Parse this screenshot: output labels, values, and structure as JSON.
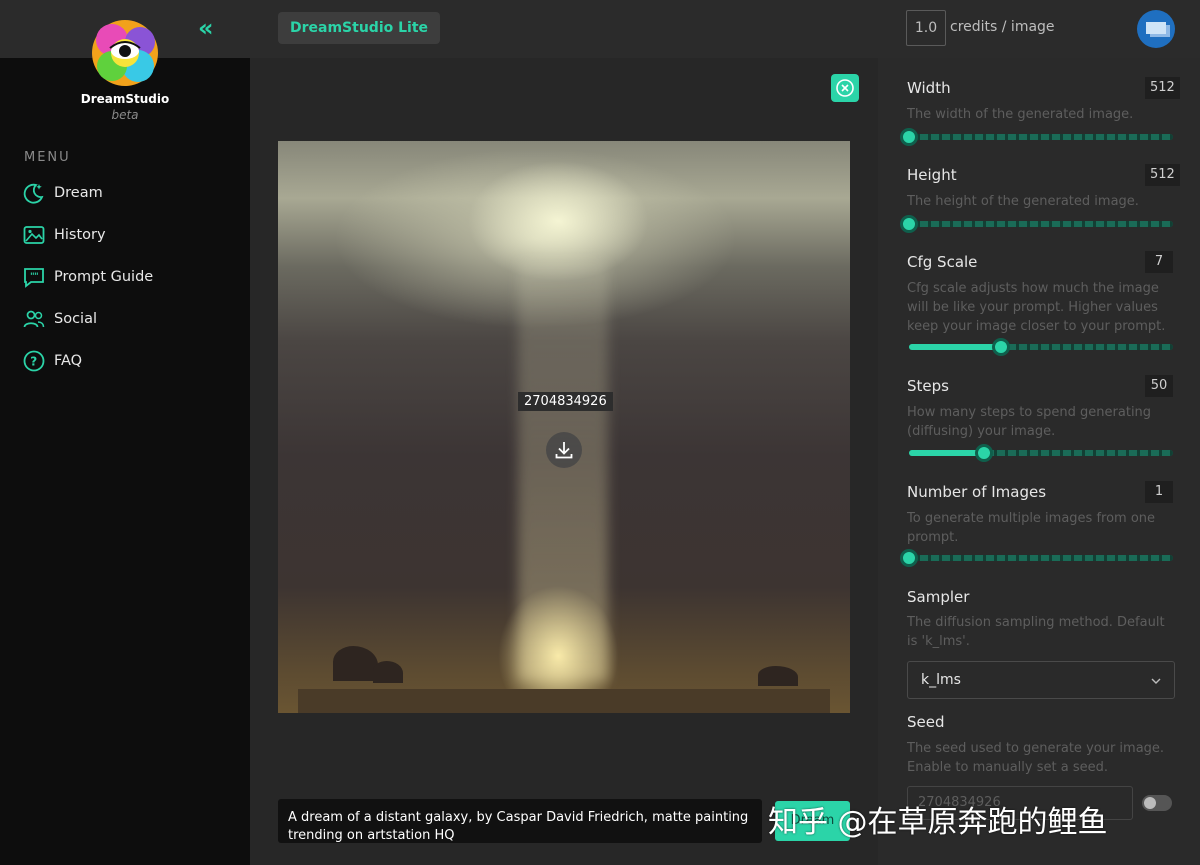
{
  "header": {
    "collapse_glyph": "«",
    "brand_pill": "DreamStudio Lite",
    "credits_value": "1.0",
    "credits_label": "credits / image"
  },
  "sidebar": {
    "logo_title": "DreamStudio",
    "logo_subtitle": "beta",
    "menu_heading": "MENU",
    "items": [
      {
        "label": "Dream",
        "icon": "moon-stars-icon"
      },
      {
        "label": "History",
        "icon": "image-icon"
      },
      {
        "label": "Prompt Guide",
        "icon": "quote-bubble-icon"
      },
      {
        "label": "Social",
        "icon": "users-icon"
      },
      {
        "label": "FAQ",
        "icon": "question-circle-icon"
      }
    ]
  },
  "main": {
    "seed_tag": "2704834926",
    "prompt": "A dream of a distant galaxy, by Caspar David Friedrich, matte painting trending on artstation HQ",
    "dream_button": "Dream"
  },
  "settings": {
    "width": {
      "title": "Width",
      "value": "512",
      "desc": "The width of the generated image.",
      "fraction": 0.0
    },
    "height": {
      "title": "Height",
      "value": "512",
      "desc": "The height of the generated image.",
      "fraction": 0.0
    },
    "cfg": {
      "title": "Cfg Scale",
      "value": "7",
      "desc": "Cfg scale adjusts how much the image will be like your prompt. Higher values keep your image closer to your prompt.",
      "fraction": 0.35
    },
    "steps": {
      "title": "Steps",
      "value": "50",
      "desc": "How many steps to spend generating (diffusing) your image.",
      "fraction": 0.285
    },
    "num_images": {
      "title": "Number of Images",
      "value": "1",
      "desc": "To generate multiple images from one prompt.",
      "fraction": 0.0
    },
    "sampler": {
      "title": "Sampler",
      "desc": "The diffusion sampling method. Default is 'k_lms'.",
      "selected": "k_lms"
    },
    "seed": {
      "title": "Seed",
      "desc": "The seed used to generate your image. Enable to manually set a seed.",
      "value": "2704834926"
    }
  },
  "watermark": "知乎 @在草原奔跑的鲤鱼",
  "colors": {
    "accent": "#2bd4a8",
    "sidebar_bg": "#0d0d0d",
    "panel_bg": "#2a2a2a"
  }
}
